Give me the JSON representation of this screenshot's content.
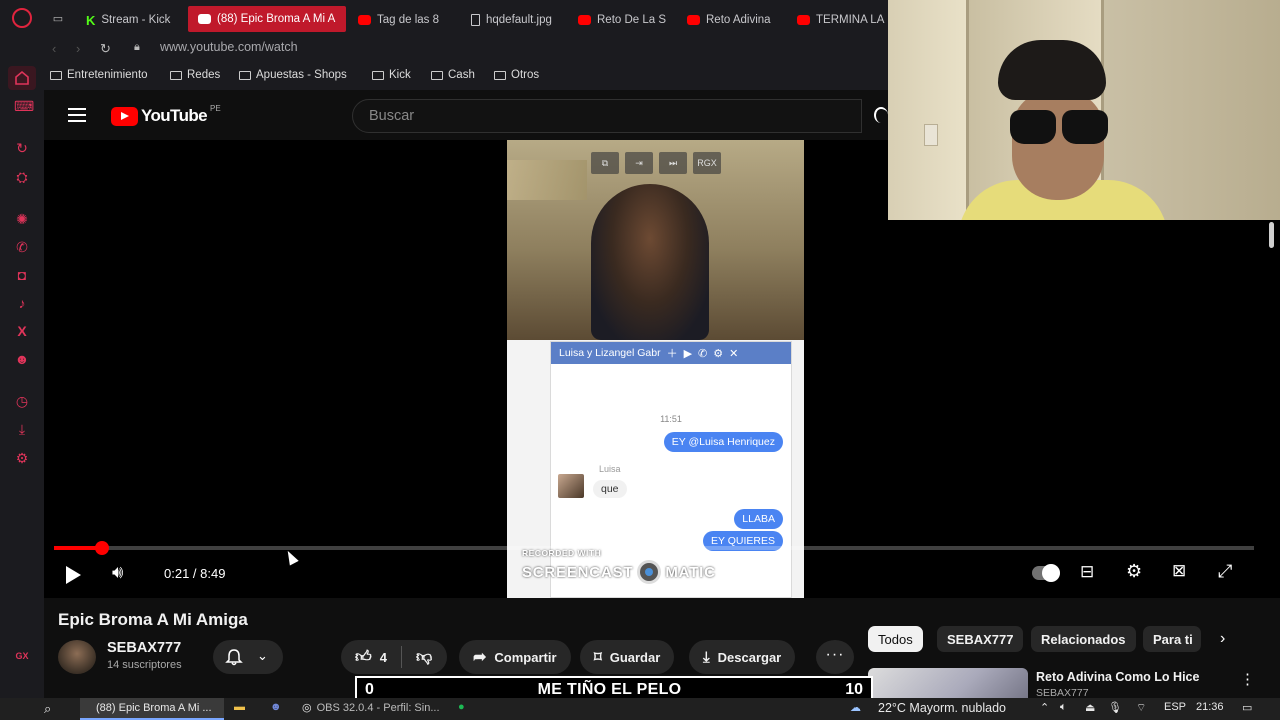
{
  "browser": {
    "tabs": [
      {
        "title": "Stream - Kick",
        "icon": "kick-icon"
      },
      {
        "title": "(88) Epic Broma A Mi A",
        "icon": "youtube-icon",
        "active": true
      },
      {
        "title": "Tag de las 8",
        "icon": "youtube-icon"
      },
      {
        "title": "hqdefault.jpg",
        "icon": "document-icon"
      },
      {
        "title": "Reto De La S",
        "icon": "youtube-icon"
      },
      {
        "title": "Reto Adivina",
        "icon": "youtube-icon"
      },
      {
        "title": "TERMINA LA",
        "icon": "youtube-icon"
      }
    ],
    "url": "www.youtube.com/watch",
    "bookmarks": [
      "Entretenimiento",
      "Redes",
      "Apuestas - Shops",
      "Kick",
      "Cash",
      "Otros"
    ]
  },
  "youtube": {
    "logo_text": "YouTube",
    "country_code": "PE",
    "search_placeholder": "Buscar"
  },
  "player": {
    "current_time": "0:21",
    "duration": "8:49",
    "time_display": "0:21 / 8:49",
    "progress_fraction": 0.04,
    "video_overlay_buttons": [
      "RGX"
    ],
    "chat": {
      "header": "Luisa y Lizangel Gabr",
      "time": "11:51",
      "messages": [
        {
          "from": "me",
          "text": "EY @Luisa Henriquez"
        },
        {
          "from": "them",
          "name": "Luisa",
          "text": "que"
        },
        {
          "from": "me",
          "text": "LLABA"
        },
        {
          "from": "me",
          "text": "EY QUIERES"
        }
      ]
    },
    "watermark_top": "RECORDED WITH",
    "watermark_brand": "SCREENCAST",
    "watermark_brand_end": "MATIC"
  },
  "video": {
    "title": "Epic Broma A Mi Amiga",
    "channel": "SEBAX777",
    "subscribers": "14 suscriptores",
    "likes": "4",
    "share_label": "Compartir",
    "save_label": "Guardar",
    "download_label": "Descargar"
  },
  "chips": [
    "Todos",
    "SEBAX777",
    "Relacionados",
    "Para ti"
  ],
  "recommendation": {
    "title": "Reto Adivina Como Lo Hice",
    "channel": "SEBAX777"
  },
  "overlay": {
    "left_number": "0",
    "text": "ME TIÑO EL PELO",
    "right_number": "10"
  },
  "taskbar": {
    "active_window": "(88) Epic Broma A Mi ...",
    "obs_window": "OBS 32.0.4 - Perfil: Sin...",
    "weather": "22°C  Mayorm. nublado",
    "language": "ESP",
    "clock": "21:36"
  },
  "sidebar_label": "GX",
  "colors": {
    "accent": "#ff0000",
    "opera_red": "#e0345a",
    "background": "#0f0f0f"
  }
}
